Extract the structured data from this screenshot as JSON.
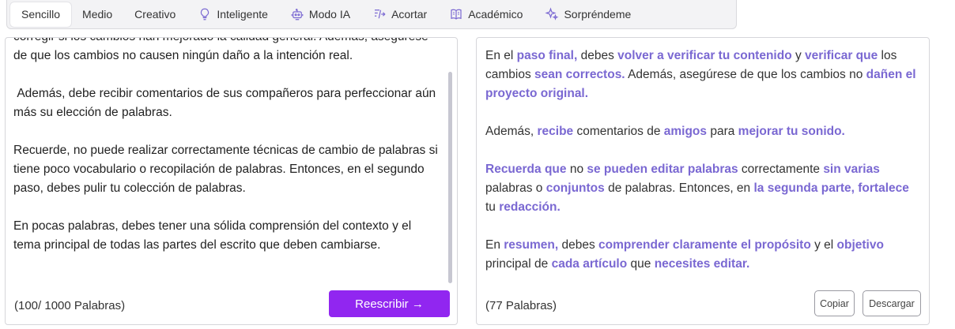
{
  "modes": [
    {
      "label": "Sencillo",
      "icon": "",
      "active": true
    },
    {
      "label": "Medio",
      "icon": "",
      "active": false
    },
    {
      "label": "Creativo",
      "icon": "",
      "active": false
    },
    {
      "label": "Inteligente",
      "icon": "lightbulb-icon",
      "active": false
    },
    {
      "label": "Modo IA",
      "icon": "robot-icon",
      "active": false
    },
    {
      "label": "Acortar",
      "icon": "shorten-icon",
      "active": false
    },
    {
      "label": "Académico",
      "icon": "book-icon",
      "active": false
    },
    {
      "label": "Sorpréndeme",
      "icon": "sparkle-icon",
      "active": false
    }
  ],
  "input": {
    "paragraphs": [
      "corregir si los cambios han mejorado la calidad general. Además, asegúrese de que los cambios no causen ningún daño a la intención real.",
      " Además, debe recibir comentarios de sus compañeros para perfeccionar aún más su elección de palabras.",
      "Recuerde, no puede realizar correctamente técnicas de cambio de palabras si tiene poco vocabulario o recopilación de palabras. Entonces, en el segundo paso, debes pulir tu colección de palabras.",
      "En pocas palabras, debes tener una sólida comprensión del contexto y el tema principal de todas las partes del escrito que deben cambiarse."
    ],
    "word_count": "(100/ 1000 Palabras)",
    "rewrite_label": "Reescribir →"
  },
  "output": {
    "paragraphs": [
      [
        {
          "t": "En el ",
          "h": false
        },
        {
          "t": "paso final,",
          "h": true
        },
        {
          "t": " debes ",
          "h": false
        },
        {
          "t": "volver a verificar tu contenido",
          "h": true
        },
        {
          "t": " y ",
          "h": false
        },
        {
          "t": "verificar que",
          "h": true
        },
        {
          "t": " los cambios ",
          "h": false
        },
        {
          "t": "sean correctos.",
          "h": true
        },
        {
          "t": " Además, asegúrese de que los cambios no ",
          "h": false
        },
        {
          "t": "dañen el proyecto original.",
          "h": true
        }
      ],
      [
        {
          "t": "Además, ",
          "h": false
        },
        {
          "t": "recibe",
          "h": true
        },
        {
          "t": " comentarios de ",
          "h": false
        },
        {
          "t": "amigos",
          "h": true
        },
        {
          "t": " para ",
          "h": false
        },
        {
          "t": "mejorar tu sonido.",
          "h": true
        }
      ],
      [
        {
          "t": "Recuerda que",
          "h": true
        },
        {
          "t": " no ",
          "h": false
        },
        {
          "t": "se pueden editar palabras",
          "h": true
        },
        {
          "t": " correctamente ",
          "h": false
        },
        {
          "t": "sin varias",
          "h": true
        },
        {
          "t": " palabras o ",
          "h": false
        },
        {
          "t": "conjuntos",
          "h": true
        },
        {
          "t": " de palabras. Entonces, en ",
          "h": false
        },
        {
          "t": "la segunda parte, fortalece",
          "h": true
        },
        {
          "t": " tu ",
          "h": false
        },
        {
          "t": "redacción.",
          "h": true
        }
      ],
      [
        {
          "t": "En ",
          "h": false
        },
        {
          "t": "resumen,",
          "h": true
        },
        {
          "t": " debes ",
          "h": false
        },
        {
          "t": "comprender claramente el propósito",
          "h": true
        },
        {
          "t": " y el ",
          "h": false
        },
        {
          "t": "objetivo",
          "h": true
        },
        {
          "t": " principal de ",
          "h": false
        },
        {
          "t": "cada artículo",
          "h": true
        },
        {
          "t": " que ",
          "h": false
        },
        {
          "t": "necesites editar.",
          "h": true
        }
      ]
    ],
    "word_count": "(77 Palabras)",
    "copy_label": "Copiar",
    "download_label": "Descargar"
  },
  "colors": {
    "accent": "#9126f0",
    "highlight": "#7a68d2"
  }
}
